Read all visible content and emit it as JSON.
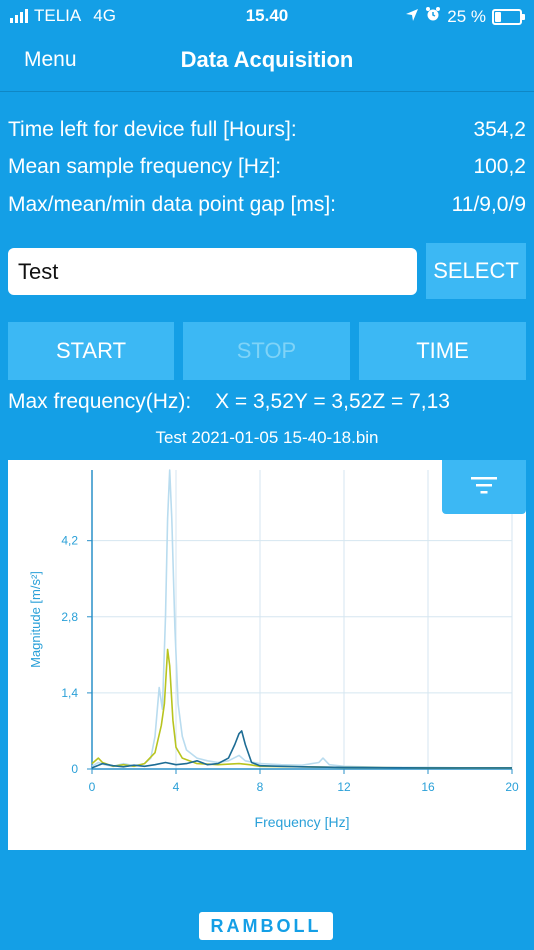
{
  "status_bar": {
    "carrier": "TELIA",
    "network": "4G",
    "time": "15.40",
    "battery_pct": 25,
    "battery_label": "25 %"
  },
  "nav": {
    "menu_label": "Menu",
    "title": "Data Acquisition"
  },
  "info": [
    {
      "label": "Time left for device full [Hours]:",
      "value": "354,2"
    },
    {
      "label": "Mean sample frequency [Hz]:",
      "value": "100,2"
    },
    {
      "label": "Max/mean/min data point gap [ms]:",
      "value": "11/9,0/9"
    }
  ],
  "name_input": {
    "value": "Test",
    "placeholder": ""
  },
  "buttons": {
    "select": "SELECT",
    "start": "START",
    "stop": "STOP",
    "time": "TIME"
  },
  "max_frequency": {
    "label": "Max frequency(Hz):",
    "x": "X = 3,52",
    "y": "Y = 3,52",
    "z": "Z = 7,13"
  },
  "file_name": "Test 2021-01-05 15-40-18.bin",
  "icons": {
    "filter": "filter-icon"
  },
  "colors": {
    "background": "#149fe6",
    "button": "#3cb8f4",
    "series_x": "#b9dcef",
    "series_y": "#b8c41f",
    "series_z": "#1d6c94",
    "axis_text": "#2aa0d8"
  },
  "logo_text": "RAMBOLL",
  "chart_data": {
    "type": "line",
    "xlabel": "Frequency [Hz]",
    "ylabel": "Magnitude [m/s²]",
    "xlim": [
      0,
      20
    ],
    "ylim": [
      0,
      5.5
    ],
    "xticks": [
      0,
      4,
      8,
      12,
      16,
      20
    ],
    "yticks": [
      0,
      1.4,
      2.8,
      4.2
    ],
    "ytick_labels": [
      "0",
      "1,4",
      "2,8",
      "4,2"
    ],
    "grid": true,
    "series": [
      {
        "key": "x",
        "color": "#b9dcef",
        "points": [
          [
            0,
            0.05
          ],
          [
            0.3,
            0.12
          ],
          [
            0.6,
            0.08
          ],
          [
            1,
            0.05
          ],
          [
            1.5,
            0.1
          ],
          [
            2,
            0.06
          ],
          [
            2.5,
            0.1
          ],
          [
            2.8,
            0.2
          ],
          [
            3,
            0.6
          ],
          [
            3.2,
            1.5
          ],
          [
            3.35,
            1.1
          ],
          [
            3.5,
            2.8
          ],
          [
            3.6,
            4.6
          ],
          [
            3.7,
            5.5
          ],
          [
            3.8,
            4.6
          ],
          [
            3.95,
            2.6
          ],
          [
            4.1,
            1.2
          ],
          [
            4.3,
            0.6
          ],
          [
            4.5,
            0.35
          ],
          [
            5,
            0.2
          ],
          [
            5.5,
            0.15
          ],
          [
            6,
            0.12
          ],
          [
            6.5,
            0.15
          ],
          [
            7,
            0.25
          ],
          [
            7.3,
            0.15
          ],
          [
            8,
            0.1
          ],
          [
            9,
            0.08
          ],
          [
            10,
            0.07
          ],
          [
            10.8,
            0.12
          ],
          [
            11,
            0.2
          ],
          [
            11.3,
            0.08
          ],
          [
            12,
            0.05
          ],
          [
            14,
            0.03
          ],
          [
            16,
            0.03
          ],
          [
            18,
            0.02
          ],
          [
            20,
            0.02
          ]
        ]
      },
      {
        "key": "y",
        "color": "#b8c41f",
        "points": [
          [
            0,
            0.1
          ],
          [
            0.3,
            0.2
          ],
          [
            0.5,
            0.12
          ],
          [
            1,
            0.05
          ],
          [
            1.5,
            0.08
          ],
          [
            2,
            0.05
          ],
          [
            2.5,
            0.1
          ],
          [
            3,
            0.3
          ],
          [
            3.3,
            0.8
          ],
          [
            3.45,
            1.2
          ],
          [
            3.6,
            2.2
          ],
          [
            3.7,
            1.9
          ],
          [
            3.85,
            0.9
          ],
          [
            4,
            0.4
          ],
          [
            4.3,
            0.2
          ],
          [
            5,
            0.1
          ],
          [
            6,
            0.08
          ],
          [
            7,
            0.1
          ],
          [
            7.5,
            0.08
          ],
          [
            8,
            0.05
          ],
          [
            10,
            0.04
          ],
          [
            12,
            0.03
          ],
          [
            16,
            0.02
          ],
          [
            20,
            0.02
          ]
        ]
      },
      {
        "key": "z",
        "color": "#1d6c94",
        "points": [
          [
            0,
            0.02
          ],
          [
            0.5,
            0.1
          ],
          [
            1,
            0.06
          ],
          [
            1.5,
            0.04
          ],
          [
            2,
            0.07
          ],
          [
            2.5,
            0.05
          ],
          [
            3,
            0.08
          ],
          [
            3.5,
            0.12
          ],
          [
            4,
            0.08
          ],
          [
            4.5,
            0.1
          ],
          [
            5,
            0.15
          ],
          [
            5.5,
            0.08
          ],
          [
            6,
            0.1
          ],
          [
            6.5,
            0.2
          ],
          [
            6.8,
            0.45
          ],
          [
            7,
            0.65
          ],
          [
            7.13,
            0.7
          ],
          [
            7.3,
            0.45
          ],
          [
            7.6,
            0.12
          ],
          [
            8,
            0.06
          ],
          [
            9,
            0.05
          ],
          [
            10,
            0.04
          ],
          [
            12,
            0.03
          ],
          [
            16,
            0.02
          ],
          [
            20,
            0.02
          ]
        ]
      }
    ]
  }
}
